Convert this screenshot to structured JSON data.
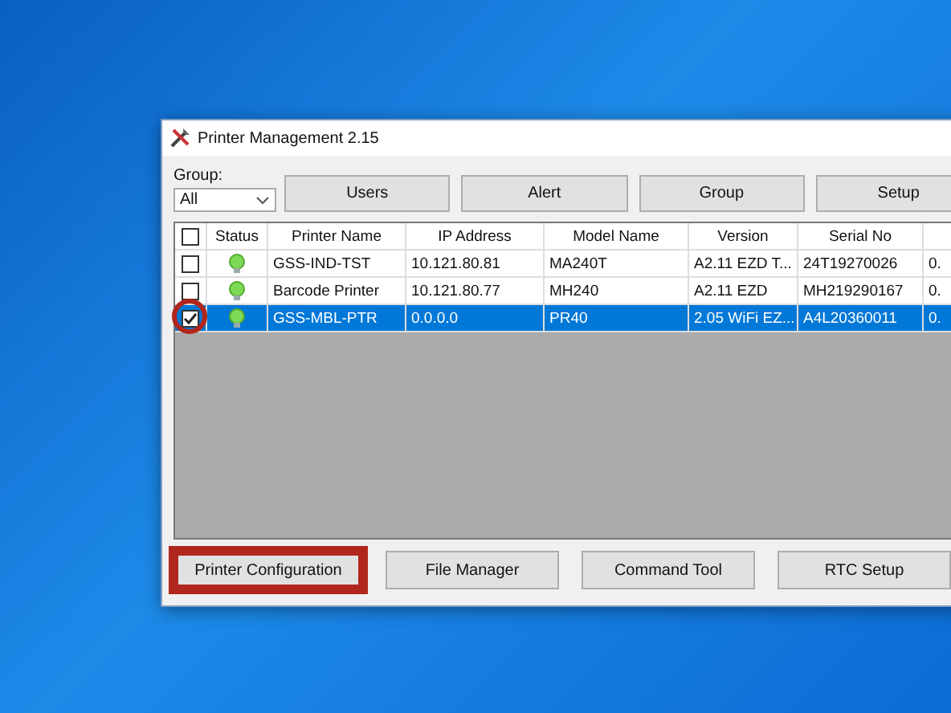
{
  "window": {
    "title": "Printer Management 2.15"
  },
  "group": {
    "label": "Group:",
    "value": "All"
  },
  "toolbar": [
    {
      "label": "Users"
    },
    {
      "label": "Alert"
    },
    {
      "label": "Group"
    },
    {
      "label": "Setup"
    }
  ],
  "table": {
    "columns": [
      "Status",
      "Printer Name",
      "IP Address",
      "Model Name",
      "Version",
      "Serial No"
    ],
    "header_checked": false,
    "rows": [
      {
        "checked": false,
        "selected": false,
        "highlighted": false,
        "cells": [
          "",
          "GSS-IND-TST",
          "10.121.80.81",
          "MA240T",
          "A2.11 EZD T...",
          "24T19270026",
          "0."
        ]
      },
      {
        "checked": false,
        "selected": false,
        "highlighted": false,
        "cells": [
          "",
          "Barcode Printer",
          "10.121.80.77",
          "MH240",
          "A2.11 EZD",
          "MH219290167",
          "0."
        ]
      },
      {
        "checked": true,
        "selected": true,
        "highlighted": true,
        "cells": [
          "",
          "GSS-MBL-PTR",
          "0.0.0.0",
          "PR40",
          "2.05 WiFi EZ...",
          "A4L20360011",
          "0."
        ]
      }
    ]
  },
  "bottom_buttons": [
    {
      "label": "Printer Configuration",
      "highlighted": true
    },
    {
      "label": "File Manager",
      "highlighted": false
    },
    {
      "label": "Command Tool",
      "highlighted": false
    },
    {
      "label": "RTC Setup",
      "highlighted": false
    }
  ]
}
